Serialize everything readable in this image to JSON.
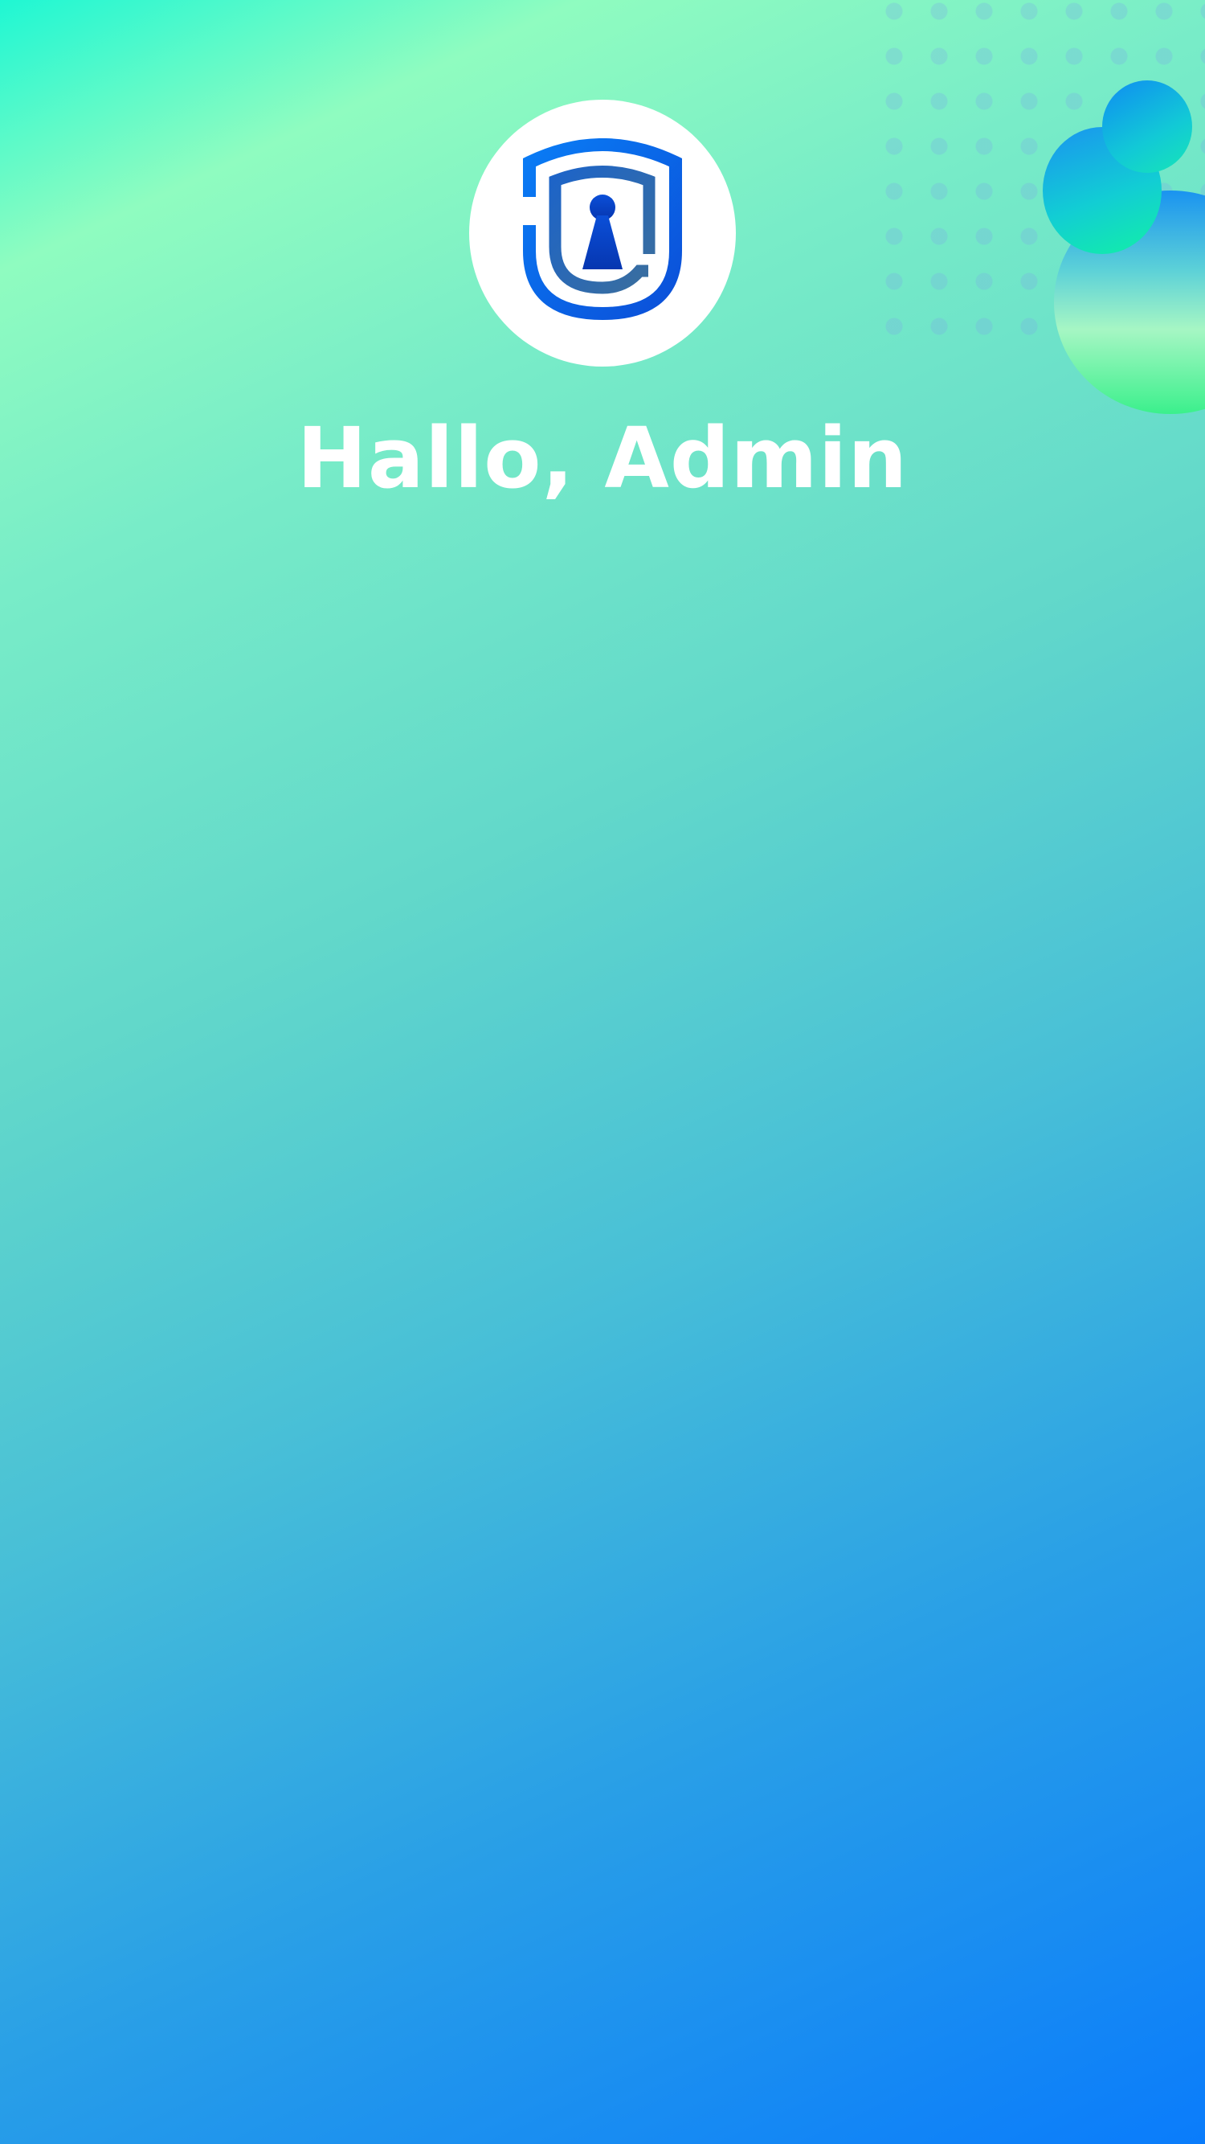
{
  "header": {
    "greeting": "Hallo, Admin",
    "logo_icon": "shield-keyhole-icon"
  },
  "colors": {
    "accent_blue": "#0a6cf0",
    "gradient_top_left": "#1ff7d3",
    "gradient_bottom_right": "#0a7cfb",
    "text": "#ffffff"
  }
}
